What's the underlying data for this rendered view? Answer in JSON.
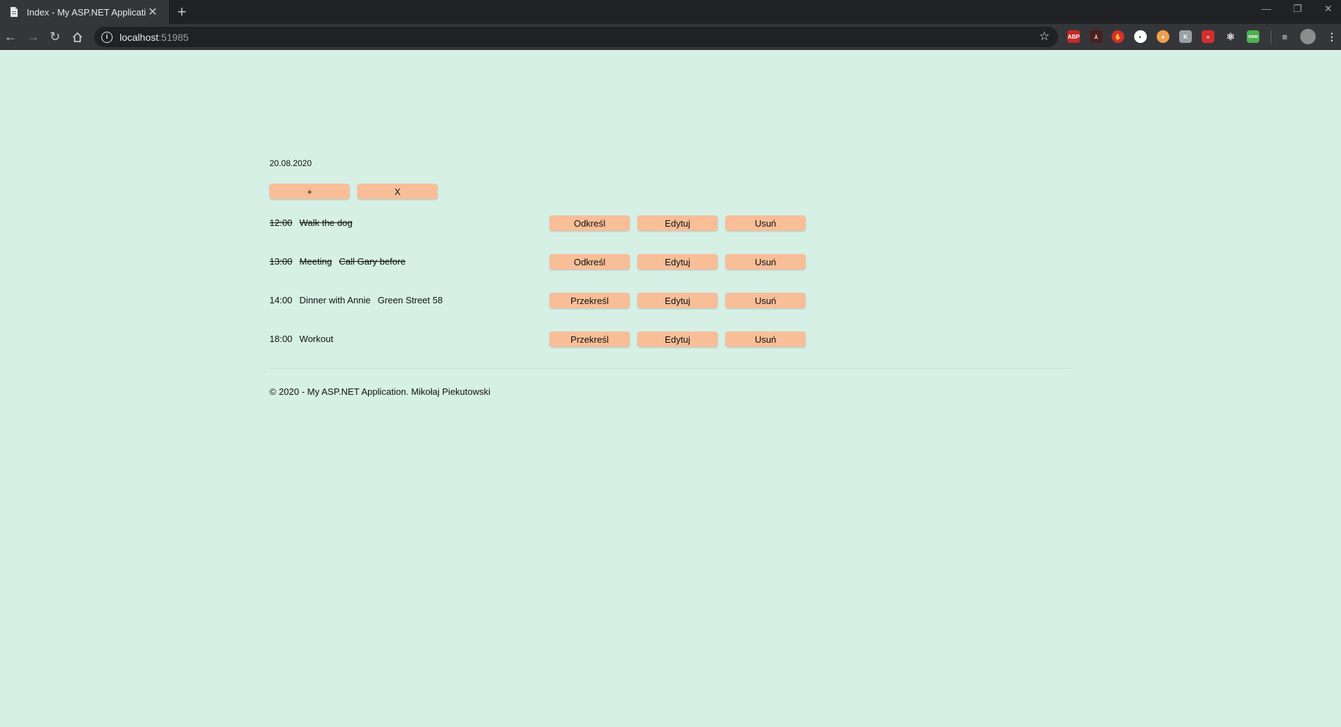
{
  "browser": {
    "tab_title": "Index - My ASP.NET Application",
    "url_host": "localhost",
    "url_port": ":51985"
  },
  "page": {
    "date": "20.08.2020",
    "add_button": "+",
    "clear_button": "X",
    "tasks": [
      {
        "time": "12:00",
        "title": "Walk the dog",
        "note": "",
        "done": true,
        "toggle_label": "Odkreśl",
        "edit_label": "Edytuj",
        "delete_label": "Usuń"
      },
      {
        "time": "13:00",
        "title": "Meeting",
        "note": "Call Gary before",
        "done": true,
        "toggle_label": "Odkreśl",
        "edit_label": "Edytuj",
        "delete_label": "Usuń"
      },
      {
        "time": "14:00",
        "title": "Dinner with Annie",
        "note": "Green Street 58",
        "done": false,
        "toggle_label": "Przekreśl",
        "edit_label": "Edytuj",
        "delete_label": "Usuń"
      },
      {
        "time": "18:00",
        "title": "Workout",
        "note": "",
        "done": false,
        "toggle_label": "Przekreśl",
        "edit_label": "Edytuj",
        "delete_label": "Usuń"
      }
    ],
    "footer": "© 2020 - My ASP.NET Application. Mikołaj Piekutowski"
  },
  "colors": {
    "page_background": "#d6f0e6",
    "button_background": "#f8be98"
  }
}
